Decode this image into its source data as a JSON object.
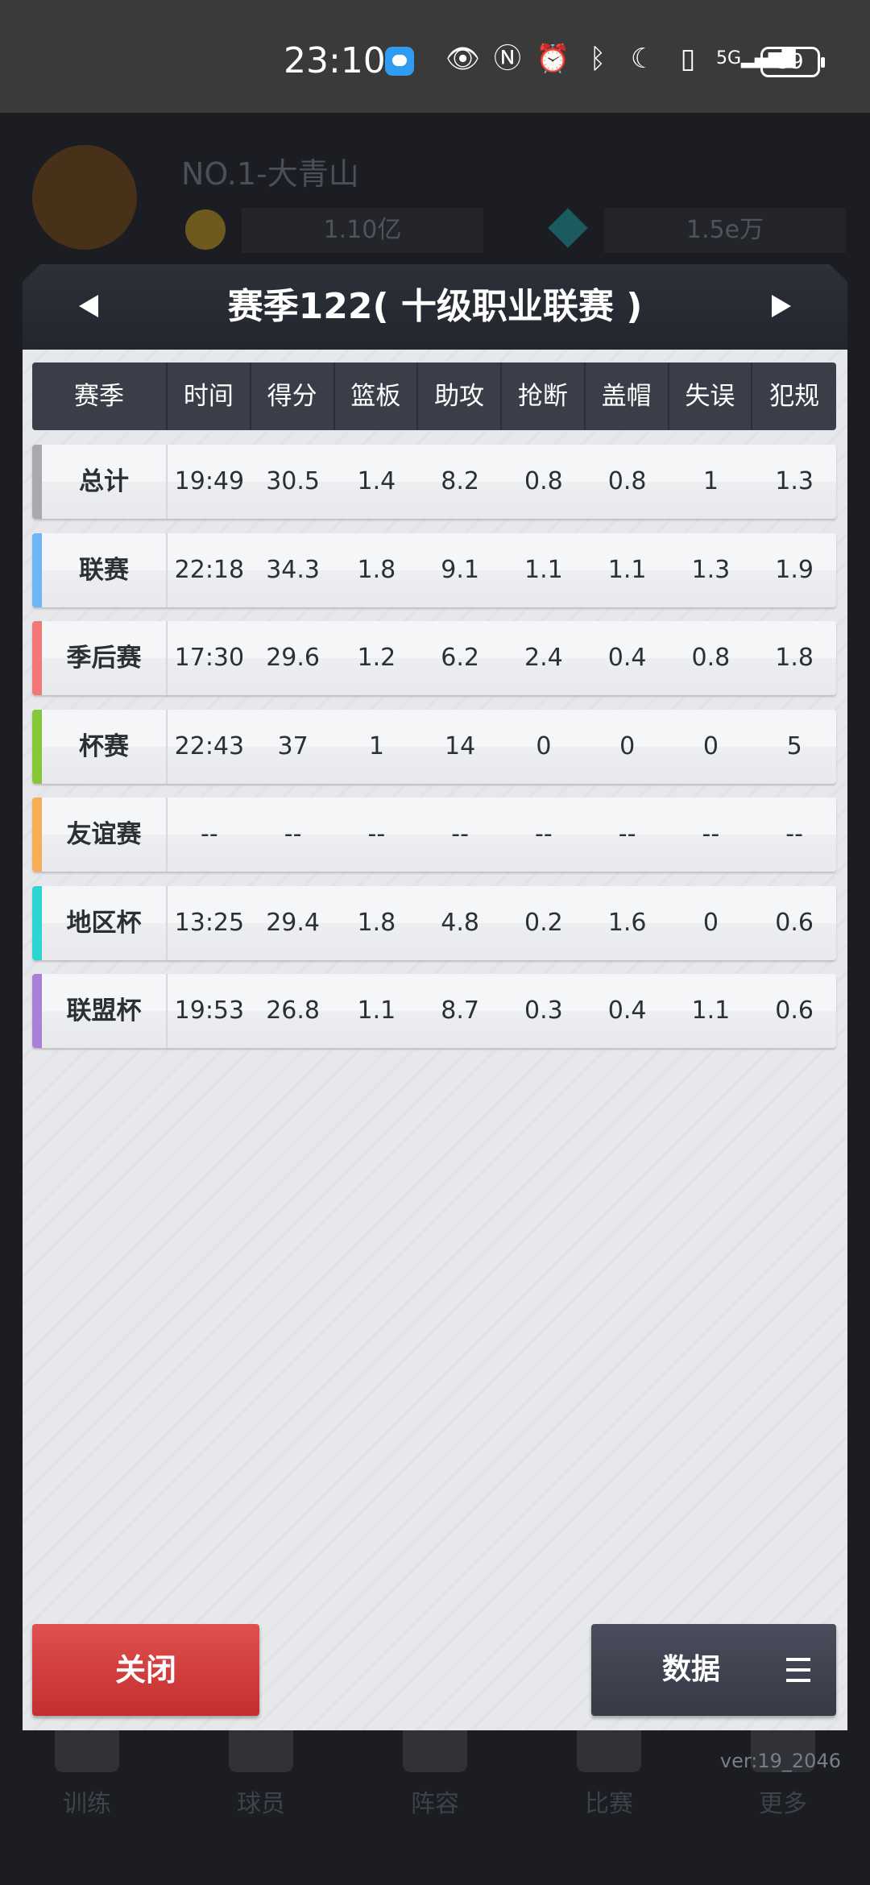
{
  "status_bar": {
    "time": "23:10",
    "battery": "59",
    "icons": [
      "message-icon",
      "eye-icon",
      "nfc-icon",
      "alarm-icon",
      "bluetooth-icon",
      "moon-icon",
      "vibrate-icon",
      "signal-5g-icon"
    ]
  },
  "background": {
    "player_name": "NO.1-大青山",
    "gold": "1.10亿",
    "gems": "1.5e万",
    "nav": [
      "训练",
      "球员",
      "阵容",
      "比赛",
      "更多"
    ],
    "version": "ver:19_2046"
  },
  "modal": {
    "title": "赛季122( 十级职业联赛 )",
    "columns": [
      "赛季",
      "时间",
      "得分",
      "篮板",
      "助攻",
      "抢断",
      "盖帽",
      "失误",
      "犯规"
    ],
    "rows": [
      {
        "name": "总计",
        "color": "#a8a9ac",
        "values": [
          "19:49",
          "30.5",
          "1.4",
          "8.2",
          "0.8",
          "0.8",
          "1",
          "1.3"
        ]
      },
      {
        "name": "联赛",
        "color": "#6fb4f5",
        "values": [
          "22:18",
          "34.3",
          "1.8",
          "9.1",
          "1.1",
          "1.1",
          "1.3",
          "1.9"
        ]
      },
      {
        "name": "季后赛",
        "color": "#f27878",
        "values": [
          "17:30",
          "29.6",
          "1.2",
          "6.2",
          "2.4",
          "0.4",
          "0.8",
          "1.8"
        ]
      },
      {
        "name": "杯赛",
        "color": "#84c83a",
        "values": [
          "22:43",
          "37",
          "1",
          "14",
          "0",
          "0",
          "0",
          "5"
        ]
      },
      {
        "name": "友谊赛",
        "color": "#f6ad55",
        "values": [
          "--",
          "--",
          "--",
          "--",
          "--",
          "--",
          "--",
          "--"
        ]
      },
      {
        "name": "地区杯",
        "color": "#2ad6cf",
        "values": [
          "13:25",
          "29.4",
          "1.8",
          "4.8",
          "0.2",
          "1.6",
          "0",
          "0.6"
        ]
      },
      {
        "name": "联盟杯",
        "color": "#ab7fd6",
        "values": [
          "19:53",
          "26.8",
          "1.1",
          "8.7",
          "0.3",
          "0.4",
          "1.1",
          "0.6"
        ]
      }
    ],
    "close_label": "关闭",
    "data_label": "数据"
  }
}
